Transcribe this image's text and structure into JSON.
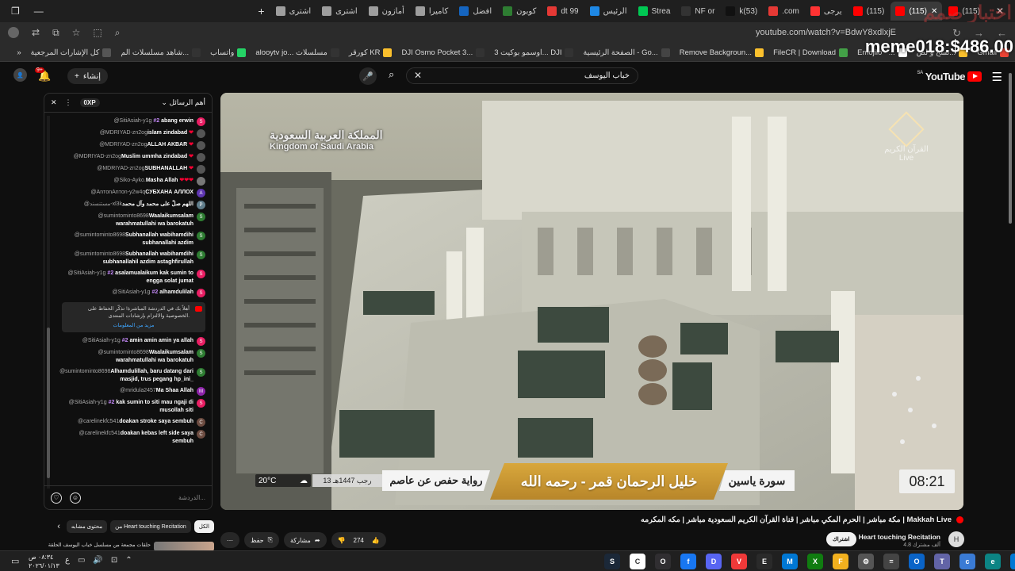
{
  "browser": {
    "tabs": [
      {
        "label": "(115)",
        "color": "#ff0000",
        "active": false
      },
      {
        "label": "(115)",
        "color": "#ff0000",
        "active": true
      },
      {
        "label": "(115)",
        "color": "#ff0000",
        "active": false
      },
      {
        "label": "يرجى",
        "color": "#ff3333",
        "active": false
      },
      {
        "label": ".com",
        "color": "#e53935",
        "active": false
      },
      {
        "label": "k(53)",
        "color": "#111111",
        "active": false
      },
      {
        "label": "NF or",
        "color": "#333333",
        "active": false
      },
      {
        "label": "Strea",
        "color": "#00c853",
        "active": false
      },
      {
        "label": "الرئيس",
        "color": "#1e88e5",
        "active": false
      },
      {
        "label": "dt 99",
        "color": "#e53935",
        "active": false
      },
      {
        "label": "كوبون",
        "color": "#2e7d32",
        "active": false
      },
      {
        "label": "افضل",
        "color": "#1565c0",
        "active": false
      },
      {
        "label": "كاميرا",
        "color": "#9e9e9e",
        "active": false
      },
      {
        "label": "أمازون",
        "color": "#9e9e9e",
        "active": false
      },
      {
        "label": "اشترى",
        "color": "#9e9e9e",
        "active": false
      },
      {
        "label": "اشترى",
        "color": "#9e9e9e",
        "active": false
      }
    ],
    "new_tab_label": "+",
    "url": "youtube.com/watch?v=BdwY8xdlxjE",
    "bookmarks": [
      {
        "label": "Gmail",
        "color": "#ea4335"
      },
      {
        "label": "نسخ و لص...",
        "color": "#fbc02d"
      },
      {
        "label": "Emojilo - ...",
        "color": "#ffffff"
      },
      {
        "label": "FileCR | Download",
        "color": "#43a047"
      },
      {
        "label": "Remove Backgroun...",
        "color": "#fbc02d"
      },
      {
        "label": "الصفحة الرئيسية - Go...",
        "color": "#444444"
      },
      {
        "label": "اوسمو بوكيت 3... DJI",
        "color": "#333333"
      },
      {
        "label": "DJI Osmo Pocket 3...",
        "color": "#333333"
      },
      {
        "label": "كورقر KR",
        "color": "#fbc02d"
      },
      {
        "label": "alooytv jo... مسلسلات",
        "color": "#333333"
      },
      {
        "label": "واتساب",
        "color": "#25d366"
      },
      {
        "label": "شاهد مسلسلات الم...",
        "color": "#333333"
      },
      {
        "label": "كل الإشارات المرجعية",
        "color": "#555555"
      }
    ],
    "overlay_text": "meme018:$486.00",
    "overlay_faint": "اختبار صمم"
  },
  "youtube": {
    "logo_text": "YouTube",
    "logo_region": "SA",
    "search": {
      "value": "خباب اليوسف",
      "placeholder": "بحث"
    },
    "create_label": "إنشاء",
    "notif_count": "9+",
    "chat": {
      "header_title": "أهم الرسائل",
      "xp_label": "0XP",
      "messages": [
        {
          "author": "@SitiAsiah-y1g",
          "badge": "#2",
          "text": "abang erwin",
          "color": "#e91e63",
          "initial": "S"
        },
        {
          "author": "@MDRIYAD-zn2og",
          "badge": "",
          "text": "islam zindabad",
          "color": "#555555",
          "initial": "",
          "hearts": 1
        },
        {
          "author": "@MDRIYAD-zn2og",
          "badge": "",
          "text": "ALLAH AKBAR",
          "color": "#555555",
          "initial": "",
          "hearts": 1
        },
        {
          "author": "@MDRIYAD-zn2og",
          "badge": "",
          "text": "Muslim ummha zindabad",
          "color": "#555555",
          "initial": "",
          "hearts": 1
        },
        {
          "author": "@MDRIYAD-zn2og",
          "badge": "",
          "text": "SUBHANALLAH",
          "color": "#555555",
          "initial": "",
          "hearts": 1
        },
        {
          "author": "@Siko-Ayko.",
          "badge": "",
          "text": "Masha Allah",
          "color": "#777777",
          "initial": "",
          "hearts": 3
        },
        {
          "author": "@AnтonAnтon-y2w4q",
          "badge": "",
          "text": "СУБХАНА АЛЛОХ",
          "color": "#5e35b1",
          "initial": "A"
        },
        {
          "author": "@مستنسند-xl3k",
          "badge": "",
          "text": "اللهم صلّ على محمد وآل محمد",
          "color": "#607d8b",
          "initial": "P"
        },
        {
          "author": "@sumintominto8698",
          "badge": "",
          "text": "Waalaikumsalam warahmatullahi wa barokatuh",
          "color": "#2e7d32",
          "initial": "S"
        },
        {
          "author": "@sumintominto8698",
          "badge": "",
          "text": "Subhanallah wabihamdihi subhanallahi azdim",
          "color": "#2e7d32",
          "initial": "S"
        },
        {
          "author": "@sumintominto8698",
          "badge": "",
          "text": "Subhanallah wabihamdihi subhanallahil azdim astaghfirullah",
          "color": "#2e7d32",
          "initial": "S"
        },
        {
          "author": "@SitiAsiah-y1g",
          "badge": "#2",
          "text": "asalamualaikum kak sumin to engga solat jumat",
          "color": "#e91e63",
          "initial": "S"
        },
        {
          "author": "@SitiAsiah-y1g",
          "badge": "#2",
          "text": "alhamdulilah",
          "color": "#e91e63",
          "initial": "S"
        }
      ],
      "pinned": {
        "text": "أهلاً بك في الدردشة المباشرة! تذكّر الحفاظ على الخصوصية والالتزام بإرشادات المنتدى.",
        "more": "مزيد من المعلومات"
      },
      "messages_after": [
        {
          "author": "@SitiAsiah-y1g",
          "badge": "#2",
          "text": "amin amin amin ya allah",
          "color": "#e91e63",
          "initial": "S"
        },
        {
          "author": "@sumintominto8698",
          "badge": "",
          "text": "Waalaikumsalam warahmatullahi wa barokatuh",
          "color": "#2e7d32",
          "initial": "S"
        },
        {
          "author": "@sumintominto8698",
          "badge": "",
          "text": "Alhamdulillah, baru datang dari masjid, trus pegang hp_ini_",
          "color": "#2e7d32",
          "initial": "S"
        },
        {
          "author": "@mridula2457",
          "badge": "",
          "text": "Ma Shaa Allah",
          "color": "#8e24aa",
          "initial": "M"
        },
        {
          "author": "@SitiAsiah-y1g",
          "badge": "#2",
          "text": "kak sumin to siti mau ngaji di musollah siti",
          "color": "#e91e63",
          "initial": "S"
        },
        {
          "author": "@carelinekfc541",
          "badge": "",
          "text": "doakan stroke saya sembuh",
          "color": "#6d4c41",
          "initial": "C"
        },
        {
          "author": "@carelinekfc541",
          "badge": "",
          "text": "doakan kebas left side saya sembuh",
          "color": "#6d4c41",
          "initial": "C"
        }
      ],
      "input_placeholder": "الدردشة..."
    },
    "video": {
      "overlay_ar": "المملكة العربية السعودية",
      "overlay_en": "Kingdom of Saudi Arabia",
      "channel_logo_text": "القرآن الكريم",
      "channel_logo_live": "Live",
      "lower_third": {
        "temp": "20°C",
        "date": "13 رجب 1447هـ",
        "rawi": "رواية حفص عن عاصم",
        "reciter": "خليل الرحمان قمر - رحمه الله",
        "surah": "سورة ياسين",
        "time": "08:21"
      }
    },
    "title": "مكة مباشر | الحرم المكي مباشر | قناة القرآن الكريم السعودية مباشر | مكه المكرمه | Makkah Live",
    "actions": {
      "likes": "274",
      "share": "مشاركة",
      "save": "حفظ",
      "subscribe": "اشتراك"
    },
    "channel": {
      "name": "Heart touching Recitation",
      "subs": "4.8 آلف مشترك",
      "initial": "H"
    },
    "rec_chips": [
      "الكل",
      "من Heart touching Recitation",
      "محتوى مشابه"
    ],
    "rec_item_text": "حلقات مجمعة من مسلسل خباب اليوسف الحلقة"
  },
  "taskbar": {
    "time": "٠٨:٣٤ ص",
    "date": "٢٠٢٦/٠١/١٣",
    "lang": "ع",
    "apps": [
      {
        "name": "steam",
        "color": "#1b2838",
        "glyph": "S"
      },
      {
        "name": "chrome",
        "color": "#ffffff",
        "glyph": "C"
      },
      {
        "name": "obs",
        "color": "#302e31",
        "glyph": "O"
      },
      {
        "name": "facebook",
        "color": "#1877f2",
        "glyph": "f"
      },
      {
        "name": "discord",
        "color": "#5865f2",
        "glyph": "D"
      },
      {
        "name": "vivaldi",
        "color": "#ef3939",
        "glyph": "V"
      },
      {
        "name": "epic",
        "color": "#2a2a2a",
        "glyph": "E"
      },
      {
        "name": "app-blue",
        "color": "#0078d4",
        "glyph": "M"
      },
      {
        "name": "xbox",
        "color": "#107c10",
        "glyph": "X"
      },
      {
        "name": "file-explorer",
        "color": "#f2b01e",
        "glyph": "F"
      },
      {
        "name": "settings",
        "color": "#555555",
        "glyph": "⚙"
      },
      {
        "name": "calculator",
        "color": "#444444",
        "glyph": "="
      },
      {
        "name": "outlook",
        "color": "#0a64c8",
        "glyph": "O"
      },
      {
        "name": "teams",
        "color": "#6264a7",
        "glyph": "T"
      },
      {
        "name": "copilot",
        "color": "#3a7bd5",
        "glyph": "c"
      },
      {
        "name": "edge",
        "color": "#0c8484",
        "glyph": "e"
      },
      {
        "name": "start",
        "color": "#0078d4",
        "glyph": "⊞"
      }
    ]
  }
}
